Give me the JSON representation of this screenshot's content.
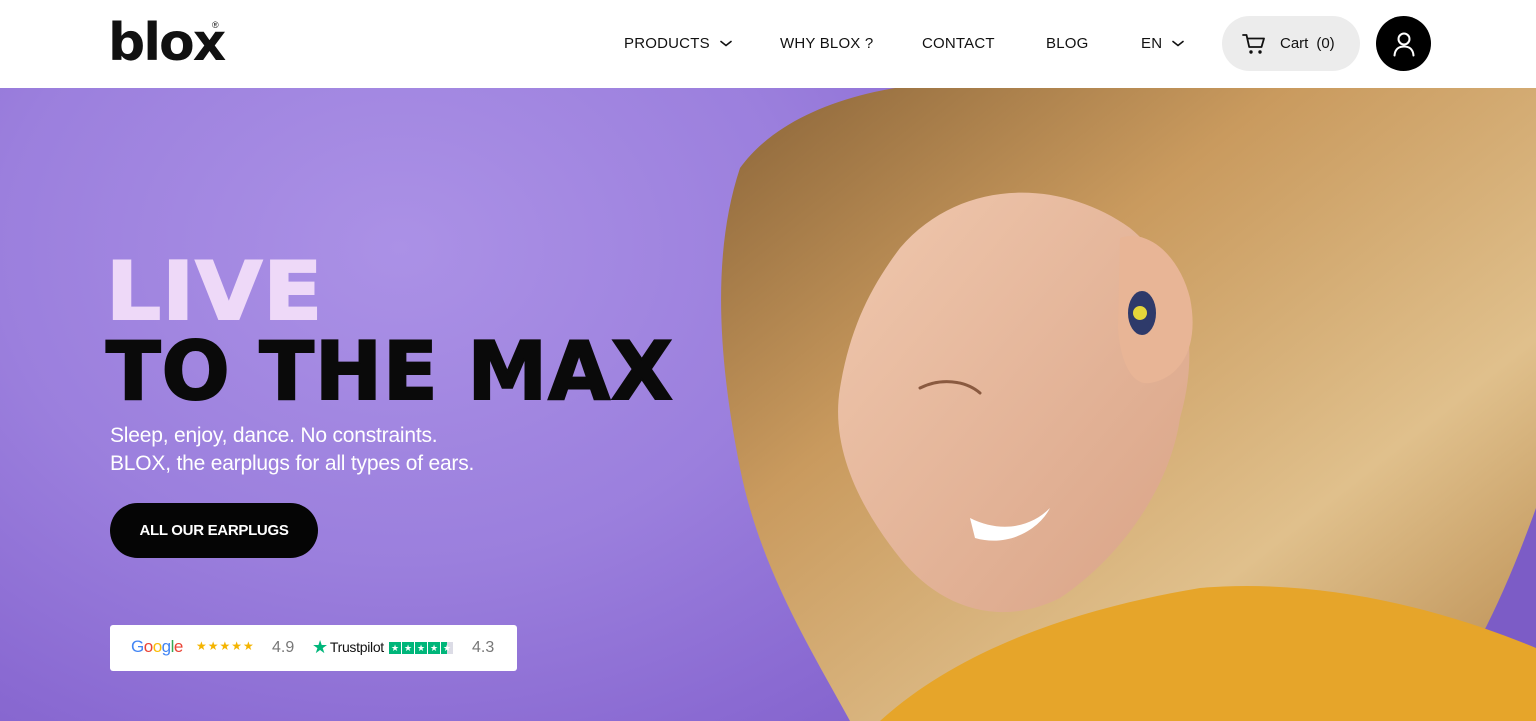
{
  "header": {
    "logo_text": "blox",
    "logo_reg": "®",
    "nav": {
      "products": "PRODUCTS",
      "why": "WHY BLOX ?",
      "contact": "CONTACT",
      "blog": "BLOG",
      "language": "EN"
    },
    "cart": {
      "label": "Cart",
      "count": "(0)"
    }
  },
  "hero": {
    "headline_1": "LIVE",
    "headline_2": "TO THE MAX",
    "subtitle_1": "Sleep, enjoy, dance. No constraints.",
    "subtitle_2": "BLOX, the earplugs for all types of ears.",
    "cta": "ALL OUR EARPLUGS"
  },
  "reviews": {
    "google": {
      "label": "Google",
      "stars": "★★★★★",
      "score": "4.9"
    },
    "trustpilot": {
      "label": "Trustpilot",
      "score": "4.3",
      "rating": 4.3
    }
  },
  "colors": {
    "hero_bg": "#9b7fdd",
    "headline_light": "#eed9f8",
    "headline_dark": "#0a0a0a",
    "cta_bg": "#050505",
    "trustpilot_green": "#00b67a",
    "google_star": "#f4b400"
  },
  "icons": [
    "chevron-down-icon",
    "cart-icon",
    "user-icon",
    "trustpilot-star-icon"
  ]
}
